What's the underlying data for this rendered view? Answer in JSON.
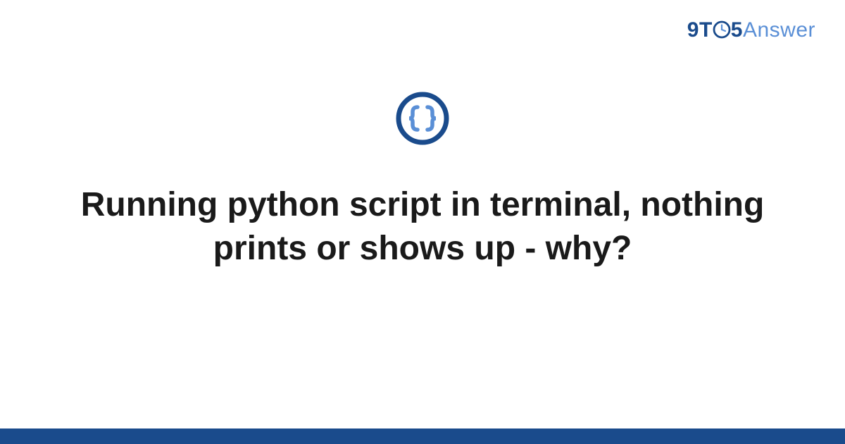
{
  "brand": {
    "part1": "9",
    "part2": "T",
    "part3": "5",
    "part4": "Answer"
  },
  "title": "Running python script in terminal, nothing prints or shows up - why?",
  "colors": {
    "primary": "#1a4b8c",
    "accent": "#5a8fd6"
  }
}
